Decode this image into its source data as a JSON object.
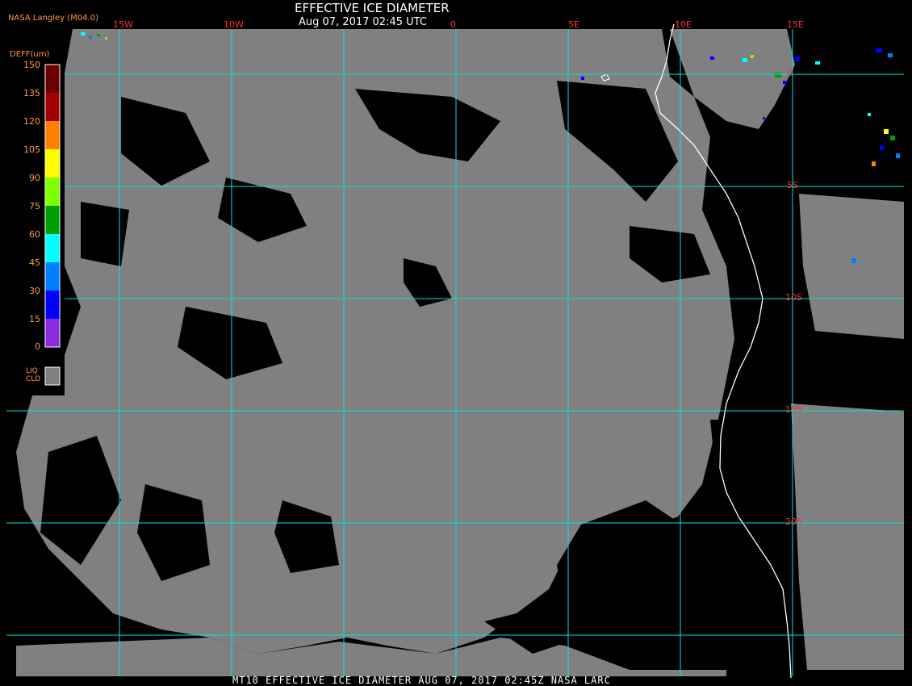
{
  "header": {
    "title": "EFFECTIVE ICE DIAMETER",
    "timestamp": "Aug 07, 2017 02:45 UTC",
    "source": "NASA Langley (M04.0)"
  },
  "footer": {
    "caption": "MT10  EFFECTIVE ICE DIAMETER   AUG 07, 2017 02:45Z   NASA LARC"
  },
  "grid": {
    "lon_labels": [
      "15W",
      "10W",
      "0",
      "5E",
      "10E",
      "15E"
    ],
    "lat_labels": [
      "0",
      "5S",
      "10S",
      "15S",
      "20S"
    ]
  },
  "legend": {
    "title": "DEFF(um)",
    "ticks": [
      "150",
      "135",
      "120",
      "105",
      "90",
      "75",
      "60",
      "45",
      "30",
      "15",
      "0"
    ],
    "colors": [
      "#6b0000",
      "#a00000",
      "#ff0000",
      "#ff7f00",
      "#ffff00",
      "#7fff00",
      "#00a000",
      "#00ffff",
      "#0080ff",
      "#0000ff",
      "#8a2be2"
    ],
    "liquid_label_line1": "LIQ",
    "liquid_label_line2": "CLD",
    "liquid_color": "#808080"
  },
  "colors": {
    "cloud_gray": "#808080",
    "grid_cyan": "#00e5e5",
    "coast_white": "#ffffff",
    "label_red": "#ff3030"
  }
}
